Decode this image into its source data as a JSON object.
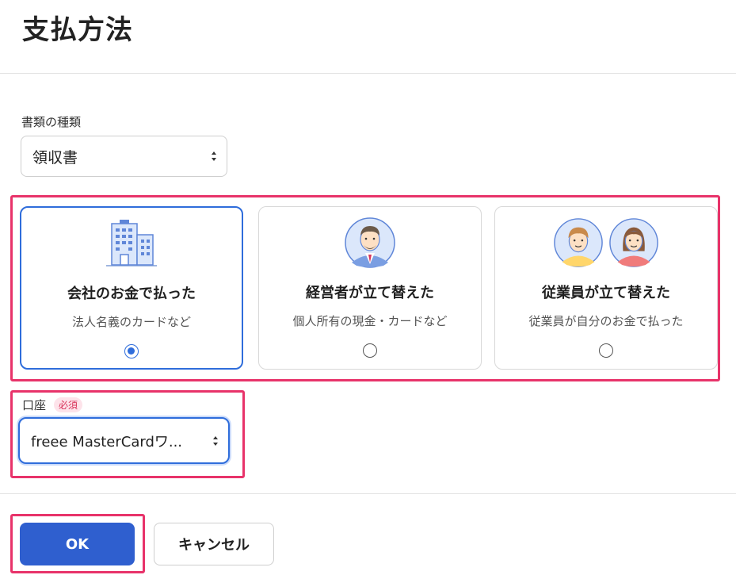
{
  "page": {
    "title": "支払方法"
  },
  "document": {
    "label": "書類の種類",
    "selected": "領収書"
  },
  "payer_options": [
    {
      "title": "会社のお金で払った",
      "subtitle": "法人名義のカードなど",
      "icon": "building-icon",
      "selected": true
    },
    {
      "title": "経営者が立て替えた",
      "subtitle": "個人所有の現金・カードなど",
      "icon": "executive-avatar-icon",
      "selected": false
    },
    {
      "title": "従業員が立て替えた",
      "subtitle": "従業員が自分のお金で払った",
      "icon": "employees-avatar-icon",
      "selected": false
    }
  ],
  "account": {
    "label": "口座",
    "required_badge": "必須",
    "selected": "freee MasterCardワ..."
  },
  "actions": {
    "ok": "OK",
    "cancel": "キャンセル"
  },
  "colors": {
    "accent": "#2f6ddb",
    "primary_button": "#2f5fcf",
    "highlight": "#e8336a",
    "required": "#d8335a"
  }
}
